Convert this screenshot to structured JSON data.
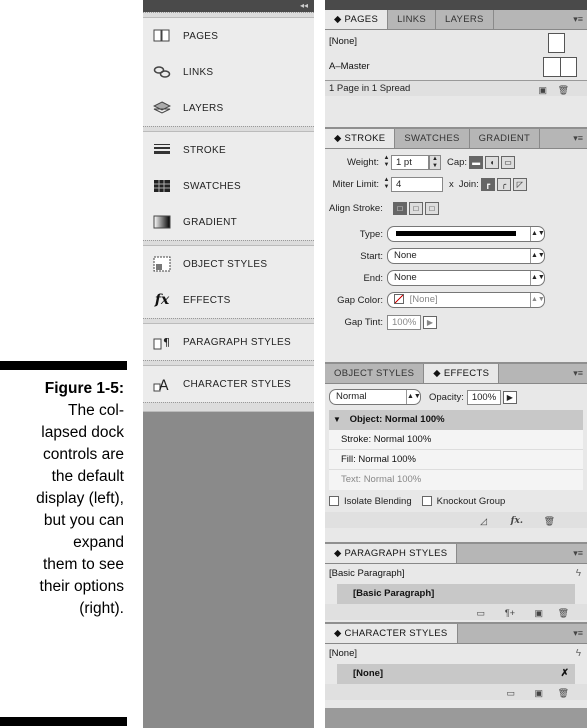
{
  "caption": {
    "figure": "Figure 1-5:",
    "lines": [
      "The col-",
      "lapsed dock",
      "controls are",
      "the default",
      "display (left),",
      "but you can",
      "expand",
      "them to see",
      "their options",
      "(right)."
    ]
  },
  "collapsed_dock": {
    "grip": "◂◂",
    "groups": [
      [
        {
          "label": "PAGES",
          "icon": "pages-icon"
        },
        {
          "label": "LINKS",
          "icon": "links-icon"
        },
        {
          "label": "LAYERS",
          "icon": "layers-icon"
        }
      ],
      [
        {
          "label": "STROKE",
          "icon": "stroke-icon"
        },
        {
          "label": "SWATCHES",
          "icon": "swatches-icon"
        },
        {
          "label": "GRADIENT",
          "icon": "gradient-icon"
        }
      ],
      [
        {
          "label": "OBJECT STYLES",
          "icon": "object-styles-icon"
        },
        {
          "label": "EFFECTS",
          "icon": "effects-icon"
        }
      ],
      [
        {
          "label": "PARAGRAPH STYLES",
          "icon": "paragraph-styles-icon"
        }
      ],
      [
        {
          "label": "CHARACTER STYLES",
          "icon": "character-styles-icon"
        }
      ]
    ]
  },
  "pages_panel": {
    "tabs": [
      "◆ PAGES",
      "LINKS",
      "LAYERS"
    ],
    "none_label": "[None]",
    "master_label": "A–Master",
    "status": "1 Page in 1 Spread"
  },
  "stroke_panel": {
    "tabs": [
      "◆ STROKE",
      "SWATCHES",
      "GRADIENT"
    ],
    "weight_label": "Weight:",
    "weight_value": "1 pt",
    "cap_label": "Cap:",
    "miter_label": "Miter Limit:",
    "miter_value": "4",
    "miter_x": "x",
    "join_label": "Join:",
    "align_label": "Align Stroke:",
    "type_label": "Type:",
    "start_label": "Start:",
    "start_value": "None",
    "end_label": "End:",
    "end_value": "None",
    "gap_color_label": "Gap Color:",
    "gap_color_value": "[None]",
    "gap_tint_label": "Gap Tint:",
    "gap_tint_value": "100%"
  },
  "effects_panel": {
    "tabs": [
      "OBJECT STYLES",
      "◆ EFFECTS"
    ],
    "blend_mode": "Normal",
    "opacity_label": "Opacity:",
    "opacity_value": "100%",
    "object_row": "Object: Normal 100%",
    "stroke_row": "Stroke:  Normal 100%",
    "fill_row": "Fill:     Normal 100%",
    "text_row": "Text:    Normal 100%",
    "isolate_label": "Isolate Blending",
    "knockout_label": "Knockout Group"
  },
  "paragraph_panel": {
    "tab": "◆ PARAGRAPH STYLES",
    "current": "[Basic Paragraph]",
    "item": "[Basic Paragraph]"
  },
  "character_panel": {
    "tab": "◆ CHARACTER STYLES",
    "current": "[None]",
    "item": "[None]"
  },
  "menu_glyph": "▾≡"
}
